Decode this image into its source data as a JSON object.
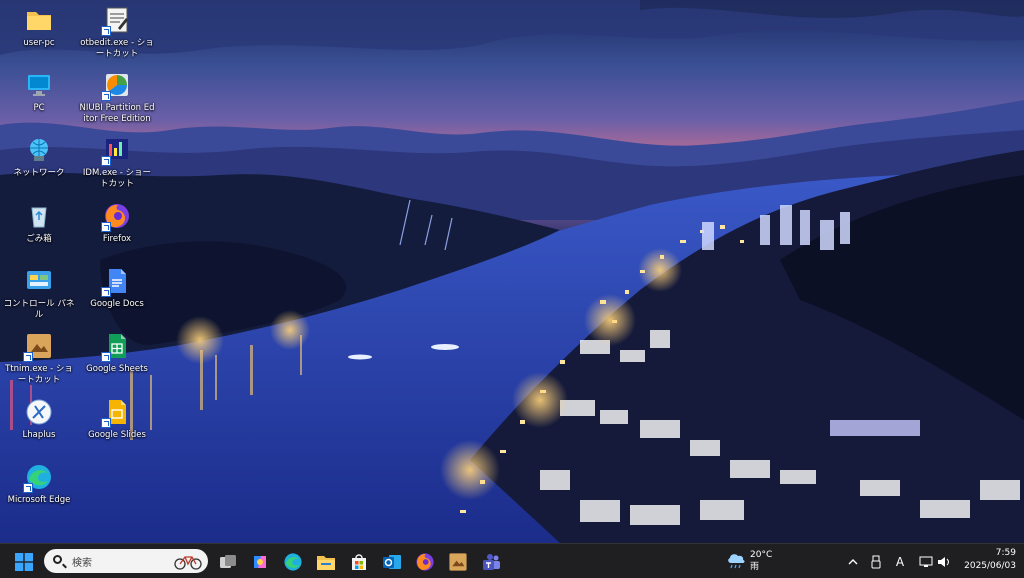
{
  "desktop": {
    "icons": [
      {
        "label": "user-pc"
      },
      {
        "label": "otbedit.exe - ショートカット"
      },
      {
        "label": "PC"
      },
      {
        "label": "NIUBI Partition Editor Free Edition"
      },
      {
        "label": "ネットワーク"
      },
      {
        "label": "IDM.exe - ショートカット"
      },
      {
        "label": "ごみ箱"
      },
      {
        "label": "Firefox"
      },
      {
        "label": "コントロール パネル"
      },
      {
        "label": "Google Docs"
      },
      {
        "label": "Ttnim.exe - ショートカット"
      },
      {
        "label": "Google Sheets"
      },
      {
        "label": "Lhaplus"
      },
      {
        "label": "Google Slides"
      },
      {
        "label": "Microsoft Edge"
      }
    ]
  },
  "taskbar": {
    "search_placeholder": "検索",
    "weather_temp": "20°C",
    "weather_cond": "雨",
    "time": "7:59",
    "date": "2025/06/03",
    "ime_mode": "A"
  },
  "colors": {
    "taskbar_bg": "#1f1f22",
    "accent": "#0078d4"
  }
}
